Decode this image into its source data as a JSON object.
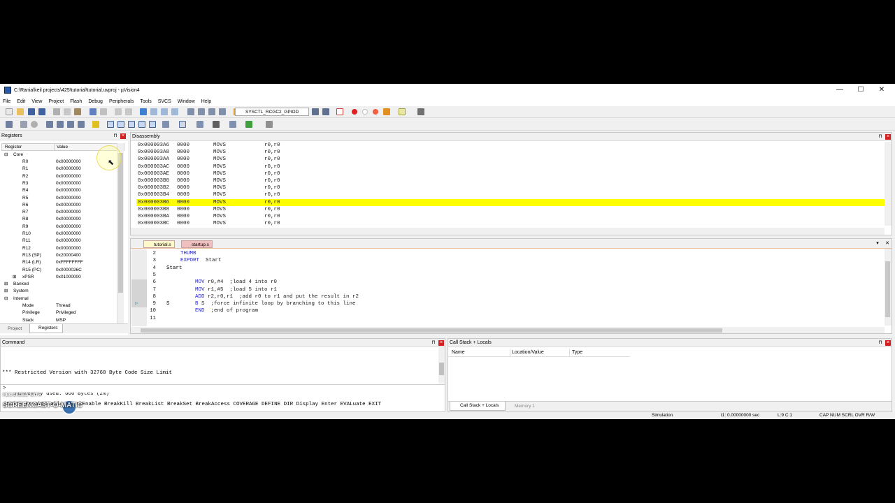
{
  "window": {
    "title": "C:\\Rania\\keil projects\\425\\tutorial\\tutorial.uvproj - µVision4"
  },
  "menu": [
    "File",
    "Edit",
    "View",
    "Project",
    "Flash",
    "Debug",
    "Peripherals",
    "Tools",
    "SVCS",
    "Window",
    "Help"
  ],
  "toolbar": {
    "target_combo": "SYSCTL_RCGC2_GPIOD"
  },
  "registers": {
    "title": "Registers",
    "col_register": "Register",
    "col_value": "Value",
    "group_core": "Core",
    "rows": [
      {
        "name": "R0",
        "value": "0x00000000"
      },
      {
        "name": "R1",
        "value": "0x00000000"
      },
      {
        "name": "R2",
        "value": "0x00000000"
      },
      {
        "name": "R3",
        "value": "0x00000000"
      },
      {
        "name": "R4",
        "value": "0x00000000"
      },
      {
        "name": "R5",
        "value": "0x00000000"
      },
      {
        "name": "R6",
        "value": "0x00000000"
      },
      {
        "name": "R7",
        "value": "0x00000000"
      },
      {
        "name": "R8",
        "value": "0x00000000"
      },
      {
        "name": "R9",
        "value": "0x00000000"
      },
      {
        "name": "R10",
        "value": "0x00000000"
      },
      {
        "name": "R11",
        "value": "0x00000000"
      },
      {
        "name": "R12",
        "value": "0x00000000"
      },
      {
        "name": "R13 (SP)",
        "value": "0x20000400"
      },
      {
        "name": "R14 (LR)",
        "value": "0xFFFFFFFF"
      },
      {
        "name": "R15 (PC)",
        "value": "0x0000026C"
      },
      {
        "name": "xPSR",
        "value": "0x01000000"
      }
    ],
    "groups": [
      "Banked",
      "System",
      "Internal"
    ],
    "internal": [
      {
        "name": "Mode",
        "value": "Thread"
      },
      {
        "name": "Privilege",
        "value": "Privileged"
      },
      {
        "name": "Stack",
        "value": "MSP"
      }
    ],
    "tab_project": "Project",
    "tab_registers": "Registers"
  },
  "disassembly": {
    "title": "Disassembly",
    "rows": [
      {
        "addr": "0x000003A6",
        "op": "0000",
        "mn": "MOVS",
        "args": "r0,r0"
      },
      {
        "addr": "0x000003A8",
        "op": "0000",
        "mn": "MOVS",
        "args": "r0,r0"
      },
      {
        "addr": "0x000003AA",
        "op": "0000",
        "mn": "MOVS",
        "args": "r0,r0"
      },
      {
        "addr": "0x000003AC",
        "op": "0000",
        "mn": "MOVS",
        "args": "r0,r0"
      },
      {
        "addr": "0x000003AE",
        "op": "0000",
        "mn": "MOVS",
        "args": "r0,r0"
      },
      {
        "addr": "0x000003B0",
        "op": "0000",
        "mn": "MOVS",
        "args": "r0,r0"
      },
      {
        "addr": "0x000003B2",
        "op": "0000",
        "mn": "MOVS",
        "args": "r0,r0"
      },
      {
        "addr": "0x000003B4",
        "op": "0000",
        "mn": "MOVS",
        "args": "r0,r0"
      },
      {
        "addr": "0x000003B6",
        "op": "0000",
        "mn": "MOVS",
        "args": "r0,r0"
      },
      {
        "addr": "0x000003B8",
        "op": "0000",
        "mn": "MOVS",
        "args": "r0,r0"
      },
      {
        "addr": "0x000003BA",
        "op": "0000",
        "mn": "MOVS",
        "args": "r0,r0"
      },
      {
        "addr": "0x000003BC",
        "op": "0000",
        "mn": "MOVS",
        "args": "r0,r0"
      }
    ],
    "highlight_color": "#ffff00"
  },
  "editor": {
    "tabs": [
      "tutorial.s",
      "startup.s"
    ],
    "lines": [
      {
        "n": "2",
        "label": "",
        "kw": "THUMB",
        "rest": ""
      },
      {
        "n": "3",
        "label": "",
        "kw": "EXPORT",
        "rest": "  Start"
      },
      {
        "n": "4",
        "label": "Start",
        "kw": "",
        "rest": ""
      },
      {
        "n": "5",
        "label": "",
        "kw": "",
        "rest": ""
      },
      {
        "n": "6",
        "label": "",
        "kw": "MOV",
        "rest": " r0,#4  ;load 4 into r0"
      },
      {
        "n": "7",
        "label": "",
        "kw": "MOV",
        "rest": " r1,#5  ;load 5 into r1"
      },
      {
        "n": "8",
        "label": "",
        "kw": "ADD",
        "rest": " r2,r0,r1  ;add r0 to r1 and put the result in r2"
      },
      {
        "n": "9",
        "label": "S",
        "kw": "B",
        "rest": " S  ;force infinite loop by branching to this line"
      },
      {
        "n": "10",
        "label": "",
        "kw": "END",
        "rest": "  ;end of program"
      },
      {
        "n": "11",
        "label": "",
        "kw": "",
        "rest": ""
      }
    ]
  },
  "command": {
    "title": "Command",
    "output": [
      "*** Restricted Version with 32768 Byte Code Size Limit",
      "*** Currently used: 660 Bytes (2%)"
    ],
    "prompt": ">",
    "hint": "ASSIGN BreakDisable BreakEnable BreakKill BreakList BreakSet BreakAccess COVERAGE DEFINE DIR Display Enter EVALuate EXIT"
  },
  "callstack": {
    "title": "Call Stack + Locals",
    "col_name": "Name",
    "col_location": "Location/Value",
    "col_type": "Type",
    "tab_callstack": "Call Stack + Locals",
    "tab_memory": "Memory 1"
  },
  "status": {
    "mode": "Simulation",
    "time": "t1: 0.00000000 sec",
    "pos": "L:9 C:1",
    "indicators": "CAP  NUM  SCRL  OVR  R/W"
  },
  "watermark": {
    "line1": "RECORDED WITH",
    "line2": "SCREENCAST-O-MATIC"
  }
}
